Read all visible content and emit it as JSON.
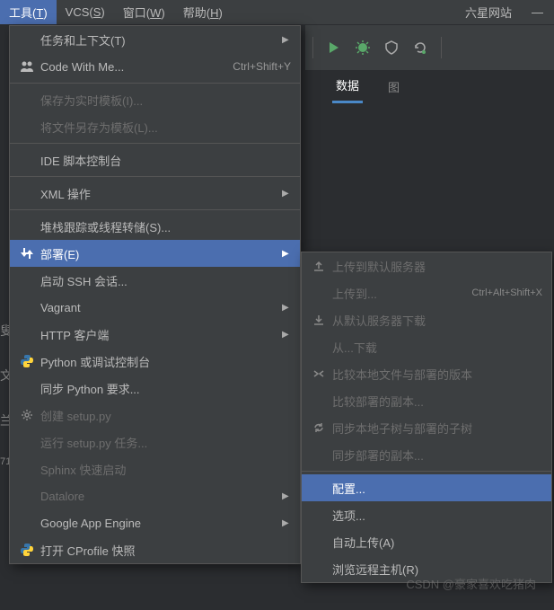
{
  "menubar": {
    "items": [
      {
        "label": "工具",
        "mnemonic": "T"
      },
      {
        "label": "VCS",
        "mnemonic": "S"
      },
      {
        "label": "窗口",
        "mnemonic": "W"
      },
      {
        "label": "帮助",
        "mnemonic": "H"
      }
    ],
    "title": "六星网站"
  },
  "tabs": {
    "items": [
      {
        "label": "数据",
        "active": true
      },
      {
        "label": "图",
        "active": false
      }
    ]
  },
  "toolsMenu": {
    "items": [
      {
        "label": "任务和上下文(T)",
        "icon": null,
        "arrow": true
      },
      {
        "label": "Code With Me...",
        "icon": "people",
        "shortcut": "Ctrl+Shift+Y"
      },
      {
        "sep": true
      },
      {
        "label": "保存为实时模板(I)...",
        "disabled": true
      },
      {
        "label": "将文件另存为模板(L)...",
        "disabled": true
      },
      {
        "sep": true
      },
      {
        "label": "IDE 脚本控制台"
      },
      {
        "sep": true
      },
      {
        "label": "XML 操作",
        "arrow": true
      },
      {
        "sep": true
      },
      {
        "label": "堆栈跟踪或线程转储(S)..."
      },
      {
        "label": "部署(E)",
        "icon": "deploy",
        "arrow": true,
        "selected": true
      },
      {
        "label": "启动 SSH 会话..."
      },
      {
        "label": "Vagrant",
        "arrow": true
      },
      {
        "label": "HTTP 客户端",
        "arrow": true
      },
      {
        "label": "Python 或调试控制台",
        "icon": "python"
      },
      {
        "label": "同步 Python 要求..."
      },
      {
        "label": "创建 setup.py",
        "icon": "gear",
        "disabled": true
      },
      {
        "label": "运行 setup.py 任务...",
        "disabled": true
      },
      {
        "label": "Sphinx 快速启动",
        "disabled": true
      },
      {
        "label": "Datalore",
        "arrow": true,
        "disabled": true
      },
      {
        "label": "Google App Engine",
        "arrow": true
      },
      {
        "label": "打开 CProfile 快照",
        "icon": "python"
      }
    ]
  },
  "deployMenu": {
    "items": [
      {
        "label": "上传到默认服务器",
        "icon": "upload",
        "disabled": true
      },
      {
        "label": "上传到...",
        "shortcut": "Ctrl+Alt+Shift+X",
        "disabled": true
      },
      {
        "label": "从默认服务器下载",
        "icon": "download",
        "disabled": true
      },
      {
        "label": "从...下载",
        "disabled": true
      },
      {
        "label": "比较本地文件与部署的版本",
        "icon": "compare",
        "disabled": true
      },
      {
        "label": "比较部署的副本...",
        "disabled": true
      },
      {
        "label": "同步本地子树与部署的子树",
        "icon": "sync",
        "disabled": true
      },
      {
        "label": "同步部署的副本...",
        "disabled": true
      },
      {
        "sep": true
      },
      {
        "label": "配置...",
        "selected": true
      },
      {
        "label": "选项..."
      },
      {
        "label": "自动上传(A)"
      },
      {
        "label": "浏览远程主机(R)"
      }
    ]
  },
  "watermark": "CSDN @豪家喜欢吃猪肉"
}
